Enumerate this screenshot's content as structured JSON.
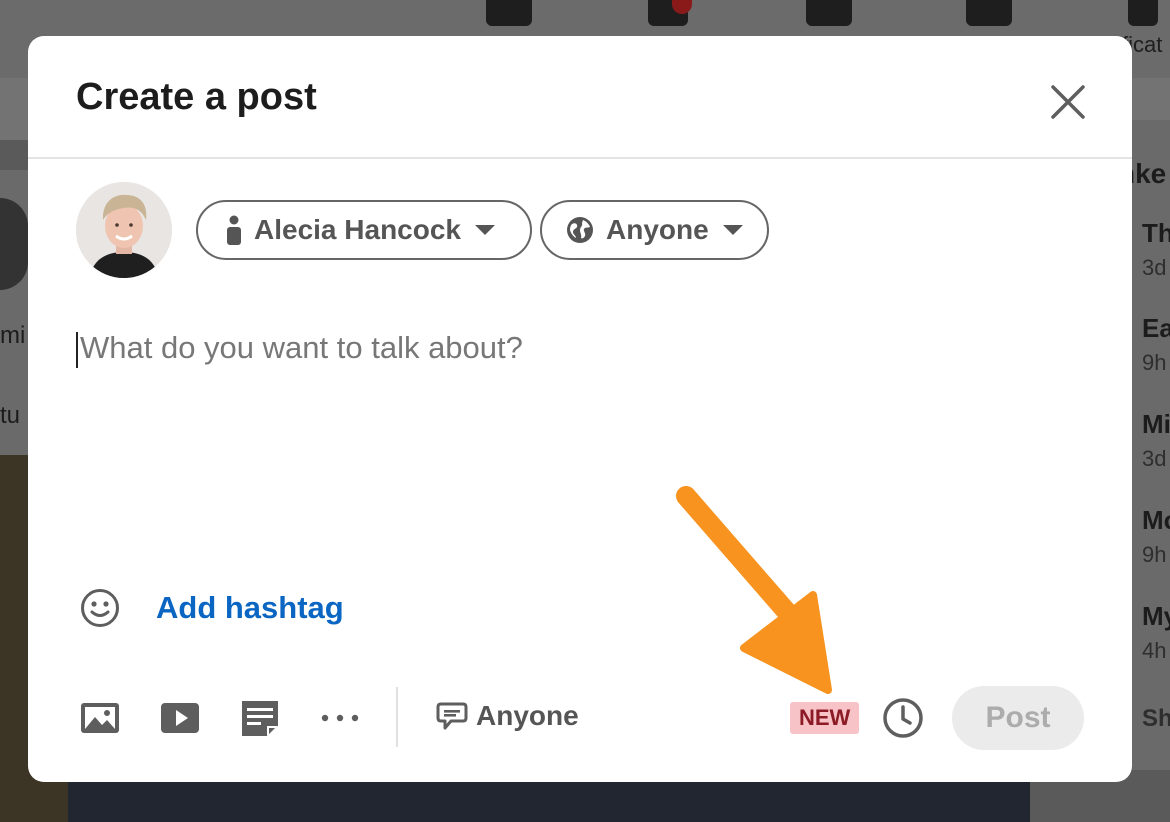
{
  "background": {
    "nav_partial_text": "ficat",
    "left_partial_text_1": "mi",
    "left_partial_text_2": "tu",
    "right_heading": "nke",
    "right_items": [
      {
        "line1": "Th",
        "line2": "3d"
      },
      {
        "line1": "Ea",
        "line2": "9h"
      },
      {
        "line1": "Mi",
        "line2": "3d"
      },
      {
        "line1": "Mo",
        "line2": "9h"
      },
      {
        "line1": "My",
        "line2": "4h"
      }
    ],
    "right_show": "Sh"
  },
  "modal": {
    "title": "Create a post",
    "author": {
      "name": "Alecia Hancock",
      "icon": "person-icon"
    },
    "audience": {
      "label": "Anyone",
      "icon": "globe-icon"
    },
    "editor": {
      "placeholder": "What do you want to talk about?"
    },
    "add_hashtag_label": "Add hashtag",
    "toolbar": {
      "tools": [
        "photo-icon",
        "video-icon",
        "document-icon",
        "more-icon"
      ],
      "comment_control": {
        "label": "Anyone",
        "icon": "comment-icon"
      },
      "new_badge": "NEW",
      "schedule_icon": "clock-icon",
      "post_label": "Post"
    }
  },
  "colors": {
    "link_blue": "#0a66c2",
    "new_badge_bg": "#f8c3c7",
    "new_badge_text": "#8c1b26",
    "arrow_orange": "#f7931e",
    "post_disabled_bg": "#ebebeb"
  }
}
